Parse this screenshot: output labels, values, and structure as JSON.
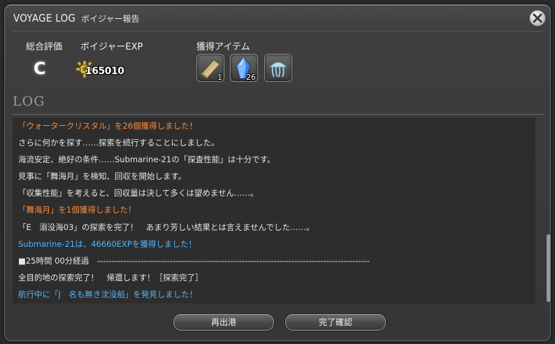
{
  "window": {
    "title_en": "VOYAGE LOG",
    "title_jp": "ボイジャー報告"
  },
  "summary": {
    "rating_label": "総合評価",
    "rating_value": "C",
    "exp_label": "ボイジャーEXP",
    "exp_value": "165010",
    "items_label": "獲得アイテム",
    "items": [
      {
        "icon": "wood-plank-icon",
        "qty": "1"
      },
      {
        "icon": "water-crystal-icon",
        "qty": "26"
      },
      {
        "icon": "jellyfish-icon",
        "qty": ""
      }
    ]
  },
  "log": {
    "heading": "LOG",
    "lines": [
      {
        "text": "「ウォータークリスタル」を26個獲得しました！",
        "color": "orange"
      },
      {
        "text": "さらに何かを探す……探索を続行することにしました。",
        "color": "white"
      },
      {
        "text": "海流安定、絶好の条件……Submarine-21の「探査性能」は十分です。",
        "color": "white"
      },
      {
        "text": "見事に「舞海月」を検知、回収を開始します。",
        "color": "white"
      },
      {
        "text": "「収集性能」を考えると、回収量は決して多くは望めません……。",
        "color": "white"
      },
      {
        "text": "「舞海月」を1個獲得しました！",
        "color": "orange"
      },
      {
        "text": "「E　溺没海03」の探索を完了！　あまり芳しい結果とは言えませんでした……。",
        "color": "white"
      },
      {
        "text": "Submarine-21は、46660EXPを獲得しました！",
        "color": "blue"
      },
      {
        "text": "■25時間 00分経過　----------------------------------------------------------------------------------------------",
        "color": "white"
      },
      {
        "text": "全目的地の探索完了！　帰還します！［探索完了］",
        "color": "white"
      },
      {
        "text": "航行中に「J　名も無き沈没船」を発見しました！",
        "color": "blue"
      }
    ]
  },
  "buttons": {
    "redeploy": "再出港",
    "finalize": "完了確認"
  },
  "colors": {
    "orange": "#ff8a3a",
    "blue": "#4fb6ff",
    "white": "#e6e6e6"
  }
}
